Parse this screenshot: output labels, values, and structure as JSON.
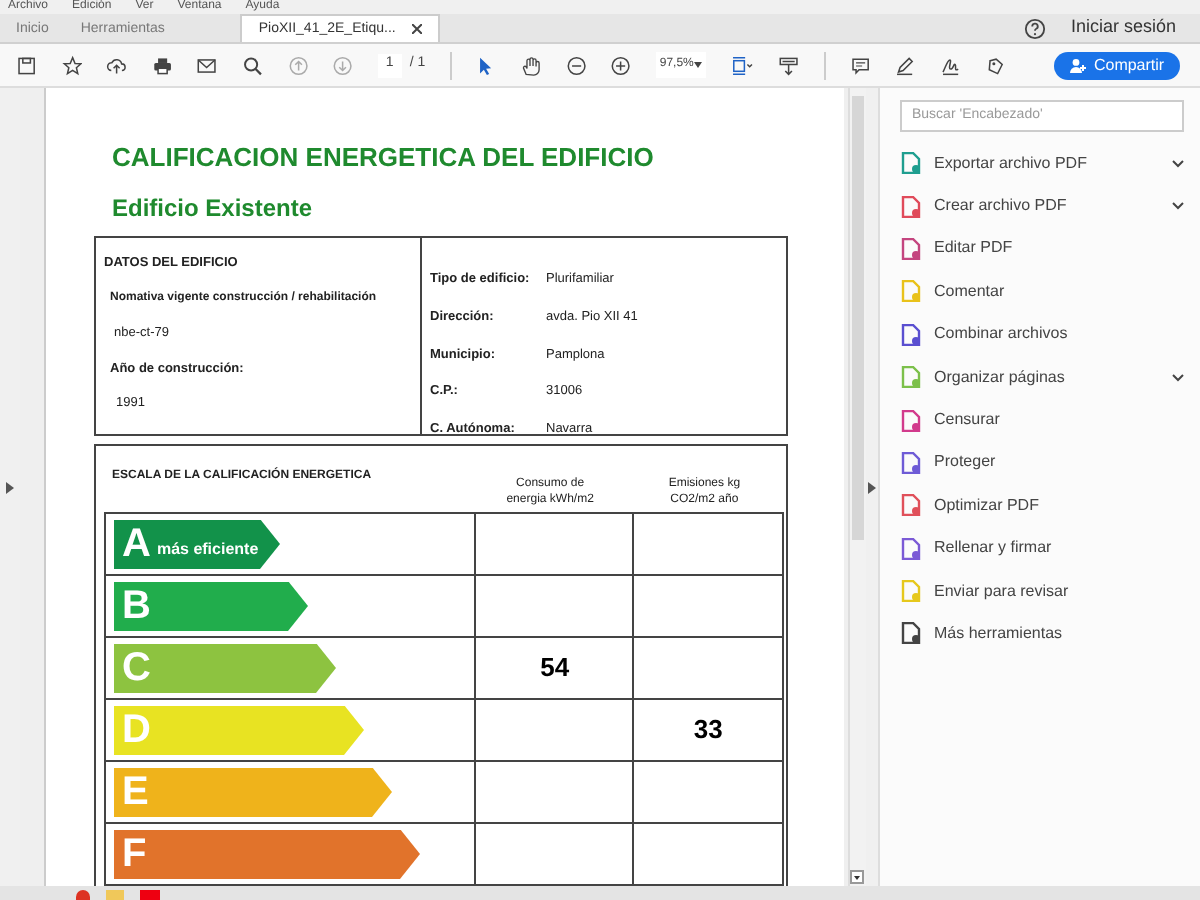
{
  "menu_bar": [
    "Archivo",
    "Edición",
    "Ver",
    "Ventana",
    "Ayuda"
  ],
  "tabs": [
    {
      "label": "Inicio",
      "selected": false,
      "closable": false
    },
    {
      "label": "Herramientas",
      "selected": false,
      "closable": false
    },
    {
      "label": "PioXII_41_2E_Etiqu...",
      "selected": true,
      "closable": true
    }
  ],
  "account": {
    "sign_in": "Iniciar sesión"
  },
  "toolbar": {
    "page_current": "1",
    "page_total": "/ 1",
    "zoom": "97,5%",
    "share_button": "Compartir"
  },
  "document": {
    "title": "CALIFICACION ENERGETICA DEL EDIFICIO",
    "subtitle": "Edificio Existente",
    "building_data": {
      "heading": "DATOS DEL EDIFICIO",
      "regulation_label": "Nomativa vigente construcción / rehabilitación",
      "regulation_value": "nbe-ct-79",
      "year_label": "Año de construcción:",
      "year_value": "1991",
      "fields": [
        {
          "label": "Tipo de edificio:",
          "value": "Plurifamiliar"
        },
        {
          "label": "Dirección:",
          "value": "avda. Pio XII 41"
        },
        {
          "label": "Municipio:",
          "value": "Pamplona"
        },
        {
          "label": "C.P.:",
          "value": "31006"
        },
        {
          "label": "C. Autónoma:",
          "value": "Navarra"
        }
      ]
    },
    "energy_scale": {
      "heading": "ESCALA DE LA CALIFICACIÓN ENERGETICA",
      "columns": [
        "Consumo de energia kWh/m2",
        "Emisiones kg CO2/m2 año"
      ],
      "rows": [
        {
          "letter": "A",
          "label": "más eficiente",
          "color": "#12924a"
        },
        {
          "letter": "B",
          "color": "#21ad4c"
        },
        {
          "letter": "C",
          "color": "#8dc340",
          "consumption": "54"
        },
        {
          "letter": "D",
          "color": "#e8e322",
          "emissions": "33"
        },
        {
          "letter": "E",
          "color": "#efb31b"
        },
        {
          "letter": "F",
          "color": "#e1732b"
        }
      ]
    }
  },
  "tools_panel": {
    "search_placeholder": "Buscar 'Encabezado'",
    "items": [
      {
        "label": "Exportar archivo PDF",
        "color": "#1e9e8f",
        "has_submenu": true
      },
      {
        "label": "Crear archivo PDF",
        "color": "#e04a5a",
        "has_submenu": true
      },
      {
        "label": "Editar PDF",
        "color": "#c4457f",
        "has_submenu": false
      },
      {
        "label": "Comentar",
        "color": "#e9c21a",
        "has_submenu": false
      },
      {
        "label": "Combinar archivos",
        "color": "#5a4fd0",
        "has_submenu": false
      },
      {
        "label": "Organizar páginas",
        "color": "#7cc04a",
        "has_submenu": true
      },
      {
        "label": "Censurar",
        "color": "#d23a8c",
        "has_submenu": false
      },
      {
        "label": "Proteger",
        "color": "#6e5bd6",
        "has_submenu": false
      },
      {
        "label": "Optimizar PDF",
        "color": "#e0505a",
        "has_submenu": false
      },
      {
        "label": "Rellenar y firmar",
        "color": "#7b5ad6",
        "has_submenu": false
      },
      {
        "label": "Enviar para revisar",
        "color": "#e6c81c",
        "has_submenu": false
      },
      {
        "label": "Más herramientas",
        "color": "#444444",
        "has_submenu": false
      }
    ]
  }
}
